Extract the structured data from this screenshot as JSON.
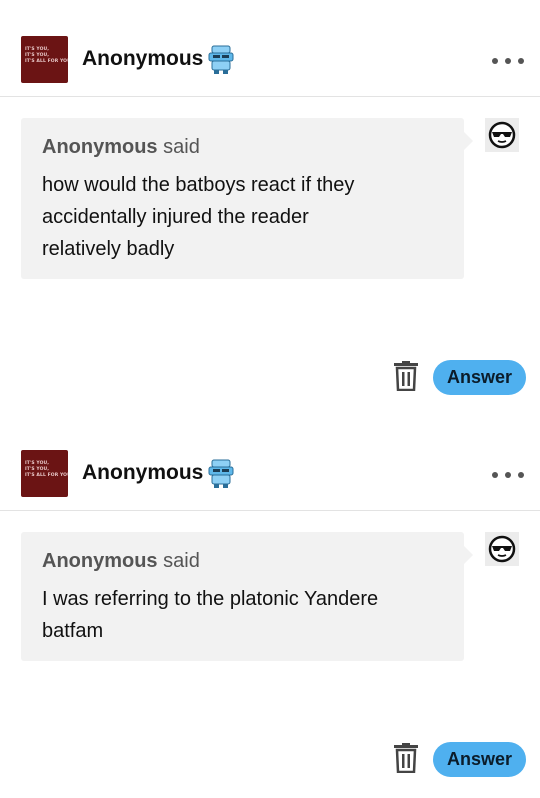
{
  "posts": [
    {
      "avatar_lines": [
        "IT'S YOU,",
        "IT'S YOU,",
        "IT'S ALL FOR YOU"
      ],
      "username": "Anonymous",
      "asker_name": "Anonymous",
      "asker_suffix": "said",
      "question_lines": [
        "how would the batboys react if they",
        "accidentally injured the reader",
        "relatively badly"
      ],
      "answer_label": "Answer"
    },
    {
      "avatar_lines": [
        "IT'S YOU,",
        "IT'S YOU,",
        "IT'S ALL FOR YOU"
      ],
      "username": "Anonymous",
      "asker_name": "Anonymous",
      "asker_suffix": "said",
      "question_lines": [
        "I was referring to the platonic Yandere",
        "batfam"
      ],
      "answer_label": "Answer"
    }
  ],
  "icons": {
    "mascot": "anonymous-mascot-icon",
    "more": "more-options-icon",
    "asker": "sunglasses-face-icon",
    "delete": "trash-icon"
  },
  "colors": {
    "answer_button": "#4fb0ef",
    "avatar_bg": "#6b1414",
    "bubble_bg": "#f2f2f2"
  }
}
